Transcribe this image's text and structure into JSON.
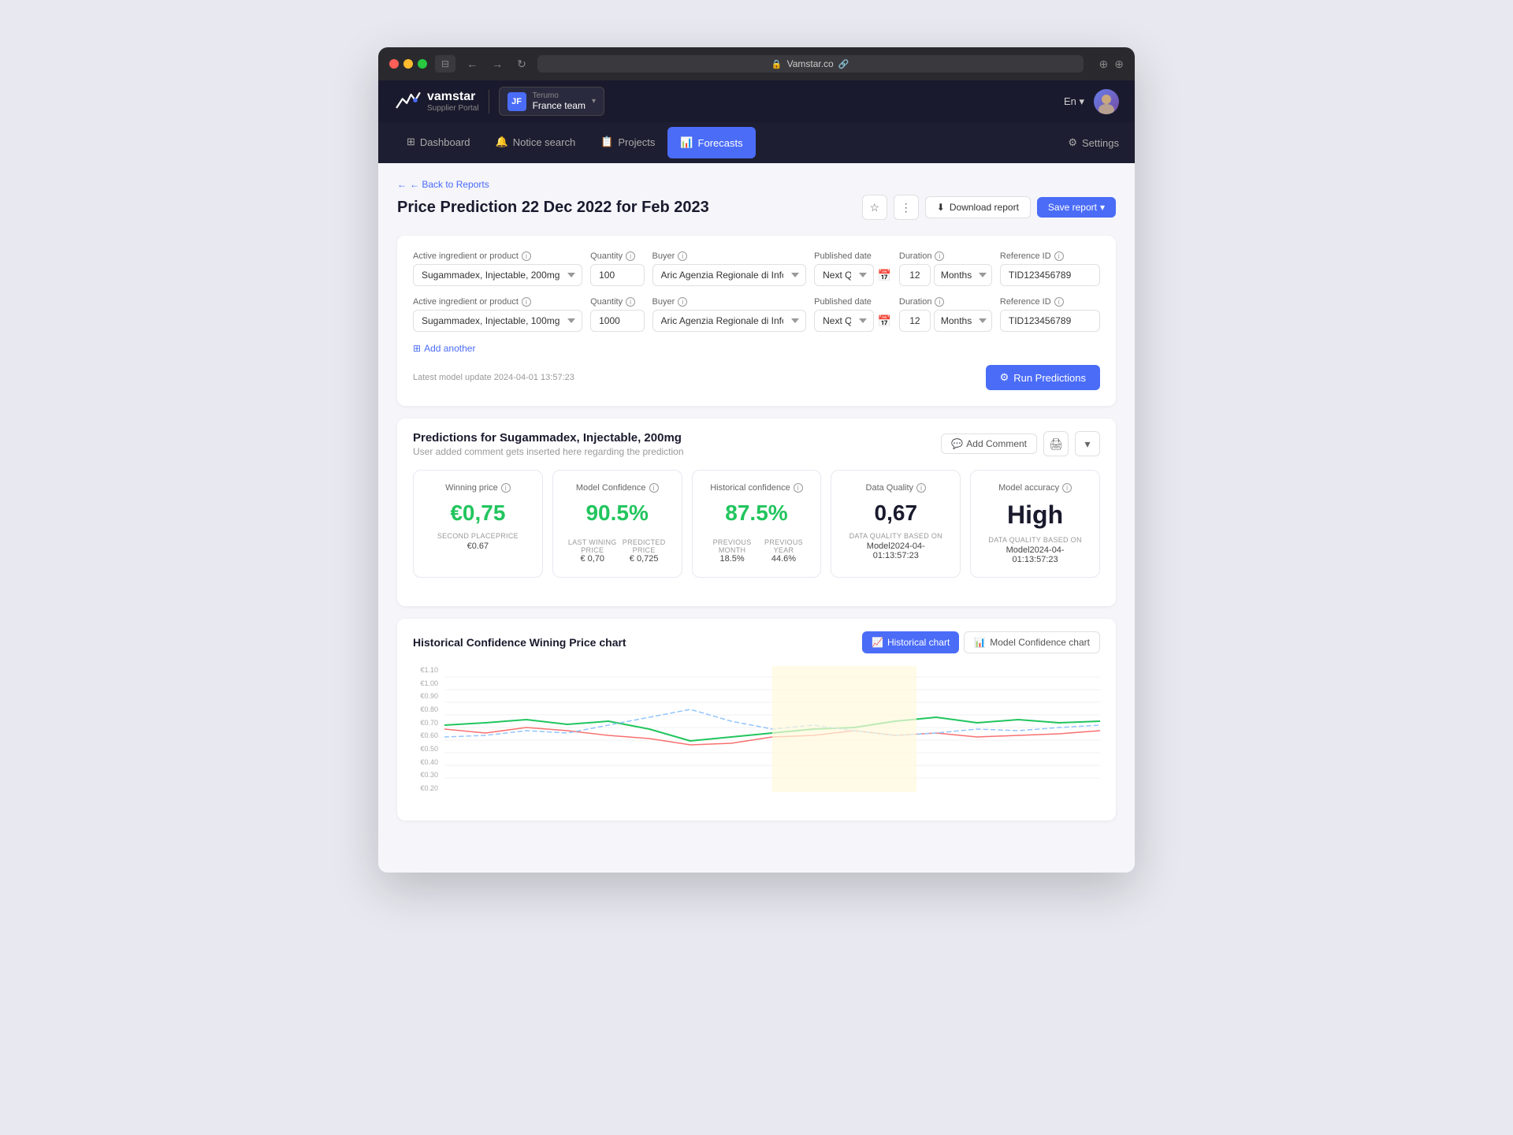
{
  "browser": {
    "url": "Vamstar.co",
    "back": "←",
    "forward": "→",
    "reload": "↻"
  },
  "header": {
    "logo_name": "vamstar",
    "logo_sub": "Supplier Portal",
    "team_initials": "JF",
    "team_company": "Terumo",
    "team_name": "France team",
    "lang": "En",
    "chevron": "▾"
  },
  "nav": {
    "items": [
      {
        "id": "dashboard",
        "label": "Dashboard",
        "icon": "⊞",
        "active": false
      },
      {
        "id": "notice-search",
        "label": "Notice search",
        "icon": "🔔",
        "active": false
      },
      {
        "id": "projects",
        "label": "Projects",
        "icon": "📋",
        "active": false
      },
      {
        "id": "forecasts",
        "label": "Forecasts",
        "icon": "📊",
        "active": true
      }
    ],
    "settings_label": "Settings",
    "settings_icon": "⚙"
  },
  "page": {
    "back_label": "← Back to Reports",
    "title": "Price Prediction 22 Dec 2022 for Feb 2023",
    "actions": {
      "star": "☆",
      "more": "⋮",
      "download": "Download report",
      "save": "Save report",
      "save_chevron": "▾"
    }
  },
  "form": {
    "rows": [
      {
        "active_ingredient_label": "Active ingredient or product",
        "active_ingredient_value": "Sugammadex, Injectable, 200mg",
        "quantity_label": "Quantity",
        "quantity_value": "100",
        "buyer_label": "Buyer",
        "buyer_value": "Aric Agenzia Regionale di Informatica e Committen",
        "published_date_label": "Published date",
        "published_date_value": "Next Quarter",
        "duration_label": "Duration",
        "duration_qty": "12",
        "duration_unit": "Months",
        "reference_label": "Reference ID",
        "reference_value": "TID123456789"
      },
      {
        "active_ingredient_label": "Active ingredient or product",
        "active_ingredient_value": "Sugammadex, Injectable, 100mg",
        "quantity_label": "Quantity",
        "quantity_value": "1000",
        "buyer_label": "Buyer",
        "buyer_value": "Aric Agenzia Regionale di Informatica e Committen",
        "published_date_label": "Published date",
        "published_date_value": "Next Quarter",
        "duration_label": "Duration",
        "duration_qty": "12",
        "duration_unit": "Months",
        "reference_label": "Reference ID",
        "reference_value": "TID123456789"
      }
    ],
    "add_another": "Add another",
    "model_update": "Latest model update 2024-04-01 13:57:23",
    "run_button": "Run Predictions"
  },
  "prediction": {
    "title": "Predictions for Sugammadex, Injectable, 200mg",
    "subtitle": "User added comment gets inserted here regarding the prediction",
    "add_comment": "Add Comment",
    "metrics": [
      {
        "id": "winning-price",
        "label": "Winning price",
        "value": "€0,75",
        "value_type": "green",
        "sub_label": "SECOND PLACEPRICE",
        "sub_values": [
          "€0.67"
        ]
      },
      {
        "id": "model-confidence",
        "label": "Model Confidence",
        "value": "90.5%",
        "value_type": "green",
        "sub_label1": "LAST WINING PRICE",
        "sub_label2": "PREDICTED PRICE",
        "sub_val1": "€ 0,70",
        "sub_val2": "€ 0,725"
      },
      {
        "id": "historical-confidence",
        "label": "Historical confidence",
        "value": "87.5%",
        "value_type": "green",
        "sub_label1": "PREVIOUS MONTH",
        "sub_label2": "PREVIOUS YEAR",
        "sub_val1": "18.5%",
        "sub_val2": "44.6%"
      },
      {
        "id": "data-quality",
        "label": "Data Quality",
        "value": "0,67",
        "value_type": "dark",
        "sub_label": "DATA QUALITY BASED ON",
        "sub_values": [
          "Model2024-04-01:13:57:23"
        ]
      },
      {
        "id": "model-accuracy",
        "label": "Model accuracy",
        "value": "High",
        "value_type": "dark",
        "sub_label": "DATA QUALITY BASED ON",
        "sub_values": [
          "Model2024-04-01:13:57:23"
        ]
      }
    ]
  },
  "chart": {
    "title": "Historical Confidence Wining Price chart",
    "tabs": [
      {
        "id": "historical",
        "label": "Historical chart",
        "active": true,
        "icon": "📈"
      },
      {
        "id": "model-confidence",
        "label": "Model Confidence chart",
        "active": false,
        "icon": "📊"
      }
    ],
    "y_labels": [
      "€1.10",
      "€1.00",
      "€0.90",
      "€0.80",
      "€0.70",
      "€0.60",
      "€0.50",
      "€0.40",
      "€0.30",
      "€0.20"
    ]
  },
  "colors": {
    "primary": "#4a6cf7",
    "green": "#22c55e",
    "dark": "#1a1a2e",
    "nav_bg": "#1a1a2e",
    "nav_active": "#4a6cf7"
  }
}
